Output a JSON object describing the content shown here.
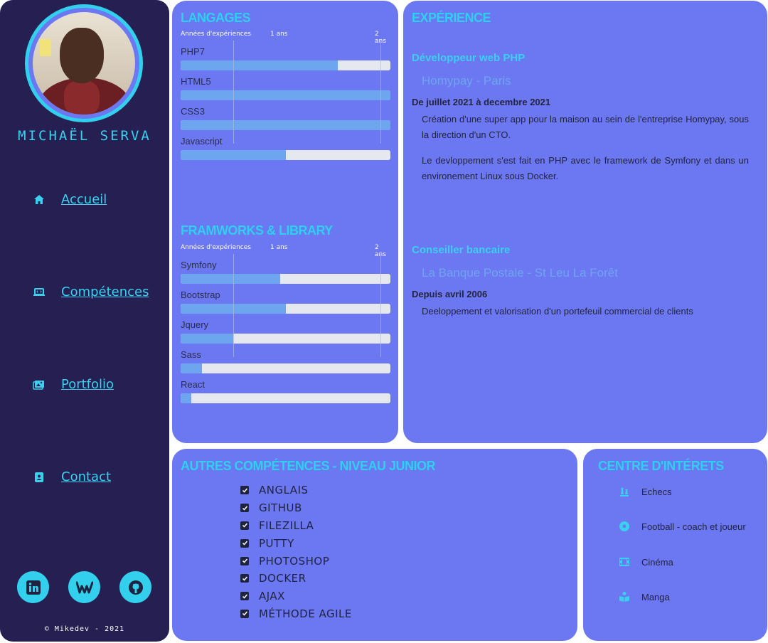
{
  "profile": {
    "name": "MICHAËL SERVA"
  },
  "nav": {
    "accueil": "Accueil",
    "competences": "Compétences",
    "portfolio": "Portfolio",
    "contact": "Contact"
  },
  "socials": [
    "linkedin-icon",
    "wordpress-icon",
    "github-icon"
  ],
  "footer": "© Mikedev - 2021",
  "langages": {
    "title": "LANGAGES",
    "axis_label": "Années d'expériences",
    "tick_1": "1 ans",
    "tick_2": "2 ans",
    "items": [
      {
        "label": "PHP7",
        "years": 1.5
      },
      {
        "label": "HTML5",
        "years": 2.0
      },
      {
        "label": "CSS3",
        "years": 2.0
      },
      {
        "label": "Javascript",
        "years": 1.0
      }
    ]
  },
  "frameworks": {
    "title": "FRAMWORKS & LIBRARY",
    "axis_label": "Années d'expériences",
    "tick_1": "1 ans",
    "tick_2": "2 ans",
    "items": [
      {
        "label": "Symfony",
        "years": 0.95
      },
      {
        "label": "Bootstrap",
        "years": 1.0
      },
      {
        "label": "Jquery",
        "years": 0.5
      },
      {
        "label": "Sass",
        "years": 0.2
      },
      {
        "label": "React",
        "years": 0.1
      }
    ]
  },
  "experience": {
    "title": "EXPÉRIENCE",
    "jobs": [
      {
        "title": "Développeur web PHP",
        "company": "Homypay - Paris",
        "dates": "De juillet 2021 à decembre 2021",
        "desc1": "Création d'une super app pour la maison au sein de l'entreprise Homypay, sous la direction d'un CTO.",
        "desc2": "Le devloppement s'est fait en PHP avec le framework de Symfony et dans un environement Linux sous Docker."
      },
      {
        "title": "Conseiller bancaire",
        "company": "La Banque Postale - St Leu La Forêt",
        "dates": "Depuis avril 2006",
        "desc1": "Deeloppement et valorisation d'un portefeuil commercial de clients"
      }
    ]
  },
  "other_skills": {
    "title": "AUTRES COMPÉTENCES - NIVEAU JUNIOR",
    "items": [
      "ANGLAIS",
      "GITHUB",
      "FILEZILLA",
      "PUTTY",
      "PHOTOSHOP",
      "DOCKER",
      "AJAX",
      "MÉTHODE AGILE"
    ]
  },
  "interests": {
    "title": "CENTRE D'INTÉRETS",
    "items": [
      {
        "icon": "chess-icon",
        "label": "Echecs"
      },
      {
        "icon": "football-icon",
        "label": "Football - coach et joueur"
      },
      {
        "icon": "film-icon",
        "label": "Cinéma"
      },
      {
        "icon": "book-reader-icon",
        "label": "Manga"
      }
    ]
  },
  "colors": {
    "sidebar": "#261f52",
    "panel": "#6c77f2",
    "accent": "#33d0ee",
    "bar_fill": "#6ea5ef",
    "bar_track": "#e6e8f0"
  }
}
